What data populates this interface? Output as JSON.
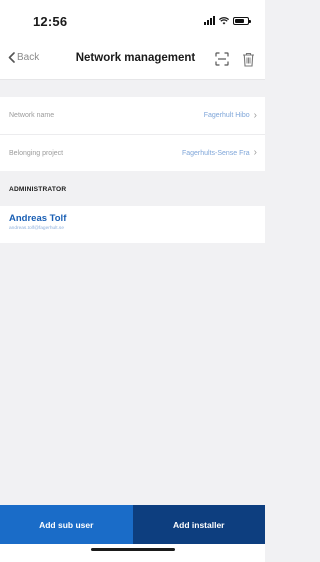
{
  "status_bar": {
    "time": "12:56"
  },
  "nav": {
    "back_label": "Back",
    "title": "Network management",
    "actions": [
      "scan-icon",
      "trash-icon"
    ]
  },
  "network_info": {
    "rows": [
      {
        "label": "Network name",
        "value": "Fagerhult Hibo"
      },
      {
        "label": "Belonging project",
        "value": "Fagerhults-Sense Fra"
      }
    ]
  },
  "administrator": {
    "section_title": "ADMINISTRATOR",
    "name": "Andreas Tolf",
    "email": "andreas.tolf@fagerhult.se"
  },
  "actions": {
    "add_sub_user": "Add sub user",
    "add_installer": "Add installer"
  },
  "colors": {
    "accent": "#1a6cc8",
    "accent_dark": "#0d3e7f",
    "link": "#1a5fb4"
  }
}
